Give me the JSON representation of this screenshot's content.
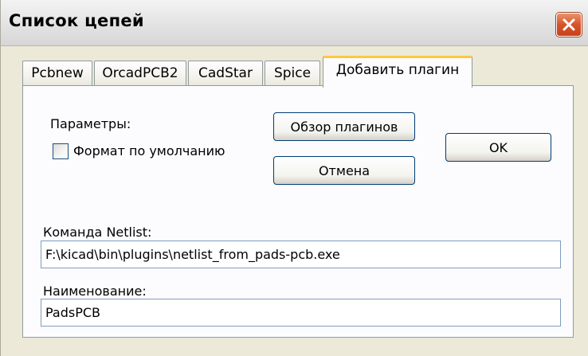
{
  "window": {
    "title": "Список цепей"
  },
  "tabs": [
    {
      "label": "Pcbnew",
      "active": false
    },
    {
      "label": "OrcadPCB2",
      "active": false
    },
    {
      "label": "CadStar",
      "active": false
    },
    {
      "label": "Spice",
      "active": false
    },
    {
      "label": "Добавить плагин",
      "active": true
    }
  ],
  "panel": {
    "params_label": "Параметры:",
    "default_format_label": "Формат по умолчанию",
    "default_format_checked": false,
    "browse_button": "Обзор плагинов",
    "cancel_button": "Отмена",
    "ok_button": "OK",
    "netlist_command_label": "Команда Netlist:",
    "netlist_command_value": "F:\\kicad\\bin\\plugins\\netlist_from_pads-pcb.exe",
    "name_label": "Наименование:",
    "name_value": "PadsPCB"
  },
  "colors": {
    "dialog_bg": "#ece9d8",
    "panel_bg": "#fcfcfe",
    "active_tab_accent": "#ffc83c",
    "close_button": "#d6542a"
  },
  "icons": {
    "close": "close-icon"
  }
}
